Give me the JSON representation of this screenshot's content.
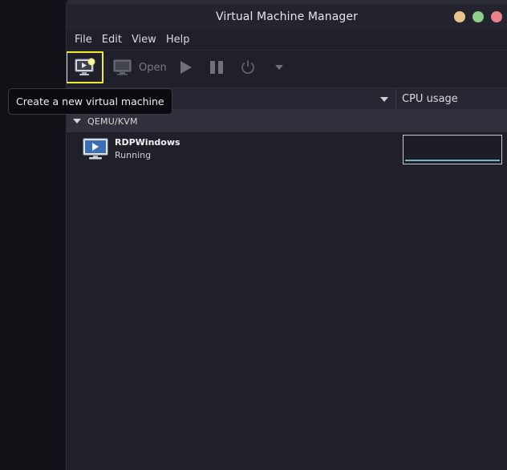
{
  "window": {
    "title": "Virtual Machine Manager",
    "controls": [
      {
        "name": "minimize",
        "color": "#e8c48a"
      },
      {
        "name": "maximize",
        "color": "#8fce8b"
      },
      {
        "name": "close",
        "color": "#e9838a"
      }
    ]
  },
  "menubar": {
    "items": [
      "File",
      "Edit",
      "View",
      "Help"
    ]
  },
  "toolbar": {
    "new_icon": "new-vm-icon",
    "open_label": "Open",
    "run_icon": "play-icon",
    "pause_icon": "pause-icon",
    "power_icon": "power-icon",
    "power_menu_icon": "chevron-down-icon",
    "highlight_color": "#f2ec2a"
  },
  "tooltip": {
    "text": "Create a new virtual machine"
  },
  "list": {
    "columns": {
      "cpu_header": "CPU usage"
    },
    "groups": [
      {
        "label": "QEMU/KVM",
        "vms": [
          {
            "name": "RDPWindows",
            "status": "Running",
            "cpu_color": "#7fb0bf"
          }
        ]
      }
    ]
  }
}
